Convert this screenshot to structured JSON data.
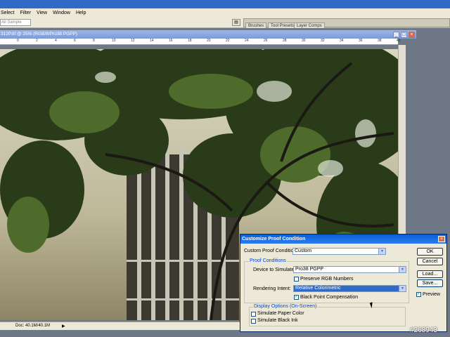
{
  "menubar": {
    "items": [
      "Select",
      "Filter",
      "View",
      "Window",
      "Help"
    ]
  },
  "options_bar": {
    "sample_size": "All Sample"
  },
  "palette_well": {
    "tabs": [
      "Brushes",
      "Tool Presets",
      "Layer Comps"
    ]
  },
  "document": {
    "title": "312P.tif @ 25% (RGB/8/Pro38 PGPP)",
    "status": "Doc: 40.1M/40.1M",
    "ruler_marks": [
      "0",
      "2",
      "4",
      "6",
      "8",
      "10",
      "12",
      "14",
      "16",
      "18",
      "20",
      "22",
      "24",
      "26",
      "28",
      "30",
      "32",
      "34",
      "36",
      "38",
      "40"
    ]
  },
  "dialog": {
    "title": "Customize Proof Condition",
    "custom_label": "Custom Proof Condition:",
    "custom_value": "Custom",
    "proof_group": "Proof Conditions",
    "device_label": "Device to Simulate:",
    "device_value": "Pro38 PGPP",
    "preserve_label": "Preserve RGB Numbers",
    "intent_label": "Rendering Intent:",
    "intent_value": "Relative Colorimetric",
    "bpc_label": "Black Point Compensation",
    "display_group": "Display Options (On-Screen)",
    "paper_label": "Simulate Paper Color",
    "ink_label": "Simulate Black Ink",
    "ok": "OK",
    "cancel": "Cancel",
    "load": "Load...",
    "save": "Save...",
    "preview": "Preview"
  },
  "watermark": "#268943"
}
